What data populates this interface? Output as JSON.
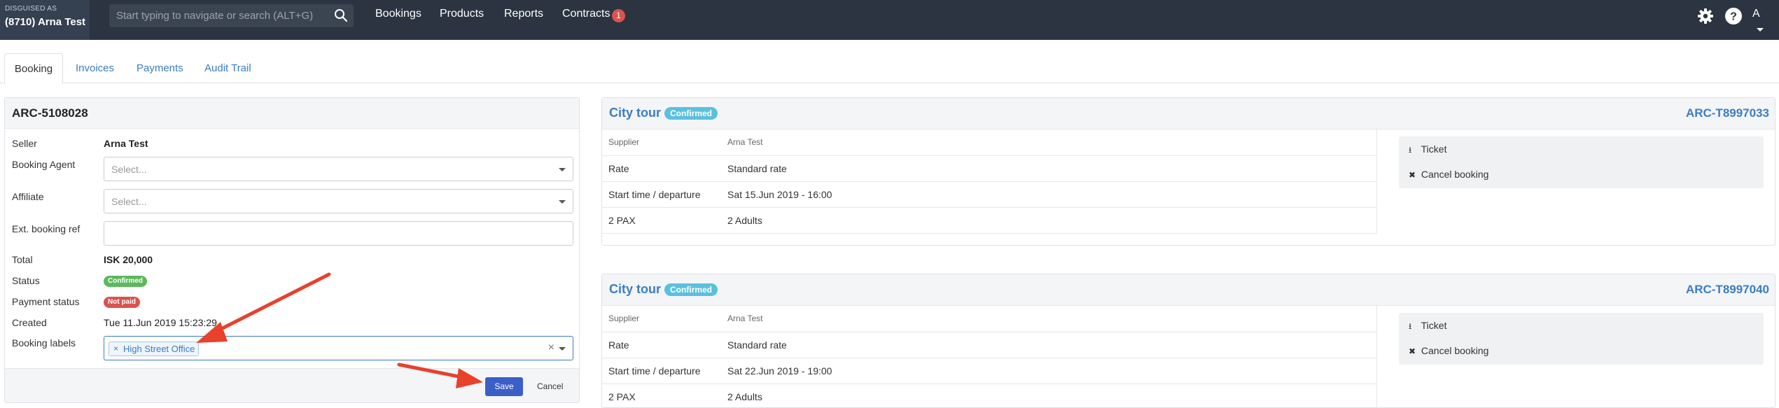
{
  "topbar": {
    "brand_small": "DISGUISED AS",
    "brand_name": "(8710) Arna Test",
    "search_placeholder": "Start typing to navigate or search (ALT+G)",
    "search_icon": "search-icon",
    "nav": [
      "Bookings",
      "Products",
      "Reports",
      "Contracts"
    ],
    "contracts_badge": "1",
    "settings_icon": "gear-icon",
    "help_icon": "help-circle-icon",
    "avatar": "A",
    "colors": {
      "bar": "#2b3440",
      "brand_bg": "#354050",
      "badge": "#d9534f"
    }
  },
  "tabs": [
    "Booking",
    "Invoices",
    "Payments",
    "Audit Trail"
  ],
  "booking": {
    "id": "ARC-5108028",
    "seller_label": "Seller",
    "seller_value": "Arna Test",
    "booking_agent_label": "Booking Agent",
    "booking_agent_placeholder": "Select...",
    "affiliate_label": "Affiliate",
    "affiliate_placeholder": "Select...",
    "ext_ref_label": "Ext. booking ref",
    "ext_ref_value": "",
    "total_label": "Total",
    "total_value": "ISK 20,000",
    "status_label": "Status",
    "status_value": "Confirmed",
    "payment_status_label": "Payment status",
    "payment_status_value": "Not paid",
    "created_label": "Created",
    "created_value": "Tue 11.Jun 2019 15:23:29",
    "booking_labels_label": "Booking labels",
    "booking_labels_tags": [
      "High Street Office"
    ],
    "tag_remove": "×",
    "clear": "×",
    "save_label": "Save",
    "cancel_label": "Cancel",
    "colors": {
      "confirmed": "#5cb85c",
      "not_paid": "#d9534f",
      "save": "#3b5fc7"
    }
  },
  "cards": [
    {
      "title": "City tour",
      "status": "Confirmed",
      "ref": "ARC-T8997033",
      "rows": [
        {
          "label": "Supplier",
          "value": "Arna Test"
        },
        {
          "label": "Rate",
          "value": "Standard rate"
        },
        {
          "label": "Start time / departure",
          "value": "Sat 15.Jun 2019 - 16:00"
        },
        {
          "label": "2 PAX",
          "value": "2 Adults"
        }
      ],
      "actions": [
        {
          "icon": "download-icon",
          "label": "Ticket"
        },
        {
          "icon": "close-icon",
          "label": "Cancel booking"
        }
      ]
    },
    {
      "title": "City tour",
      "status": "Confirmed",
      "ref": "ARC-T8997040",
      "rows": [
        {
          "label": "Supplier",
          "value": "Arna Test"
        },
        {
          "label": "Rate",
          "value": "Standard rate"
        },
        {
          "label": "Start time / departure",
          "value": "Sat 22.Jun 2019 - 19:00"
        },
        {
          "label": "2 PAX",
          "value": "2 Adults"
        }
      ],
      "actions": [
        {
          "icon": "download-icon",
          "label": "Ticket"
        },
        {
          "icon": "close-icon",
          "label": "Cancel booking"
        }
      ]
    }
  ],
  "annotation": {
    "arrow_color": "#e8412c"
  }
}
